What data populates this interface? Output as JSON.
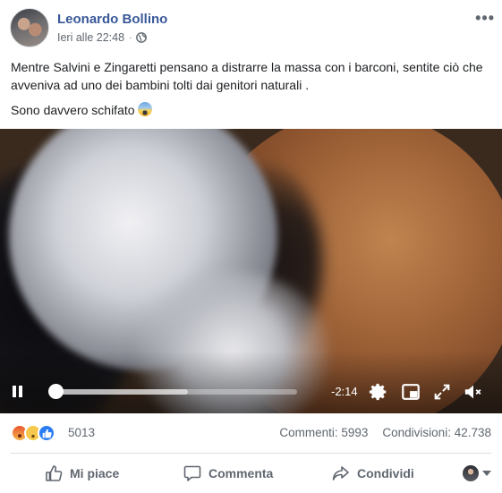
{
  "post": {
    "author": "Leonardo Bollino",
    "timestamp": "Ieri alle 22:48",
    "separator": "·",
    "audience_icon": "globe-icon",
    "more_icon": "more-options-icon",
    "more_label": "•••",
    "body_line1": "Mentre Salvini e Zingaretti pensano a distrarre la massa con i barconi, sentite ciò che avveniva ad uno dei bambini tolti dai genitori naturali .",
    "body_line2": "Sono davvero schifato",
    "body_emoji": "fearful-face-emoji"
  },
  "video": {
    "time_remaining": "-2:14",
    "progress": 0.0,
    "buffered": 0.55,
    "controls": [
      "pause-icon",
      "settings-icon",
      "picture-in-picture-icon",
      "fullscreen-icon",
      "muted-volume-icon"
    ]
  },
  "reactions": {
    "emojis": [
      "angry-reaction-icon",
      "sad-reaction-icon",
      "like-reaction-icon"
    ],
    "count": "5013",
    "comments": "Commenti: 5993",
    "shares": "Condivisioni: 42.738"
  },
  "actions": {
    "like": "Mi piace",
    "comment": "Commenta",
    "share": "Condividi"
  },
  "colors": {
    "author_link": "#385898",
    "secondary_text": "#606770",
    "like_blue": "#2b7df3"
  }
}
